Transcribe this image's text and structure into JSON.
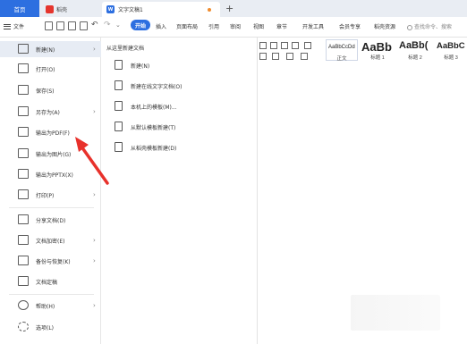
{
  "tabs": {
    "home": "首页",
    "daoke": "稻壳",
    "doc": "文字文稿1",
    "new_tab": "+"
  },
  "menubar": {
    "file": "文件",
    "start": "开始",
    "items": [
      "插入",
      "页面布局",
      "引用",
      "审阅",
      "视图",
      "章节",
      "开发工具",
      "会员专享",
      "稻壳资源"
    ],
    "search": "查找命令、搜索"
  },
  "ribbon": {
    "styles": [
      {
        "sample": "AaBbCcDd",
        "name": "正文"
      },
      {
        "sample": "AaBb",
        "name": "标题 1"
      },
      {
        "sample": "AaBb(",
        "name": "标题 2"
      },
      {
        "sample": "AaBbC",
        "name": "标题 3"
      }
    ]
  },
  "file_menu": {
    "items": [
      {
        "label": "新建(N)",
        "icon": "new-doc-icon",
        "chevron": "›"
      },
      {
        "label": "打开(O)",
        "icon": "folder-open-icon",
        "chevron": ""
      },
      {
        "label": "保存(S)",
        "icon": "save-icon",
        "chevron": ""
      },
      {
        "label": "另存为(A)",
        "icon": "save-as-icon",
        "chevron": "›"
      },
      {
        "label": "输出为PDF(F)",
        "icon": "pdf-export-icon",
        "chevron": ""
      },
      {
        "label": "输出为图片(G)",
        "icon": "image-export-icon",
        "chevron": ""
      },
      {
        "label": "输出为PPTX(X)",
        "icon": "pptx-export-icon",
        "chevron": ""
      },
      {
        "label": "打印(P)",
        "icon": "print-icon",
        "chevron": "›"
      },
      {
        "label": "分享文档(D)",
        "icon": "share-icon",
        "chevron": ""
      },
      {
        "label": "文档加密(E)",
        "icon": "encrypt-icon",
        "chevron": "›"
      },
      {
        "label": "备份与恢复(K)",
        "icon": "backup-icon",
        "chevron": "›"
      },
      {
        "label": "文档定稿",
        "icon": "finalize-icon",
        "chevron": ""
      },
      {
        "label": "帮助(H)",
        "icon": "help-icon",
        "chevron": "›"
      },
      {
        "label": "选项(L)",
        "icon": "gear-icon",
        "chevron": ""
      }
    ]
  },
  "submenu": {
    "title": "从这里新建文档",
    "items": [
      {
        "label": "新建(N)",
        "icon": "blank-doc-icon"
      },
      {
        "label": "新建在线文字文档(O)",
        "icon": "online-doc-icon"
      },
      {
        "label": "本机上的模板(M)...",
        "icon": "local-template-icon"
      },
      {
        "label": "从默认模板新建(T)",
        "icon": "default-template-icon"
      },
      {
        "label": "从稻壳模板新建(D)",
        "icon": "daoke-template-icon"
      }
    ]
  },
  "colors": {
    "accent": "#2d6fe0",
    "brand_red": "#e5352d",
    "arrow_red": "#e8312b",
    "active_row": "#e7ecf4"
  }
}
